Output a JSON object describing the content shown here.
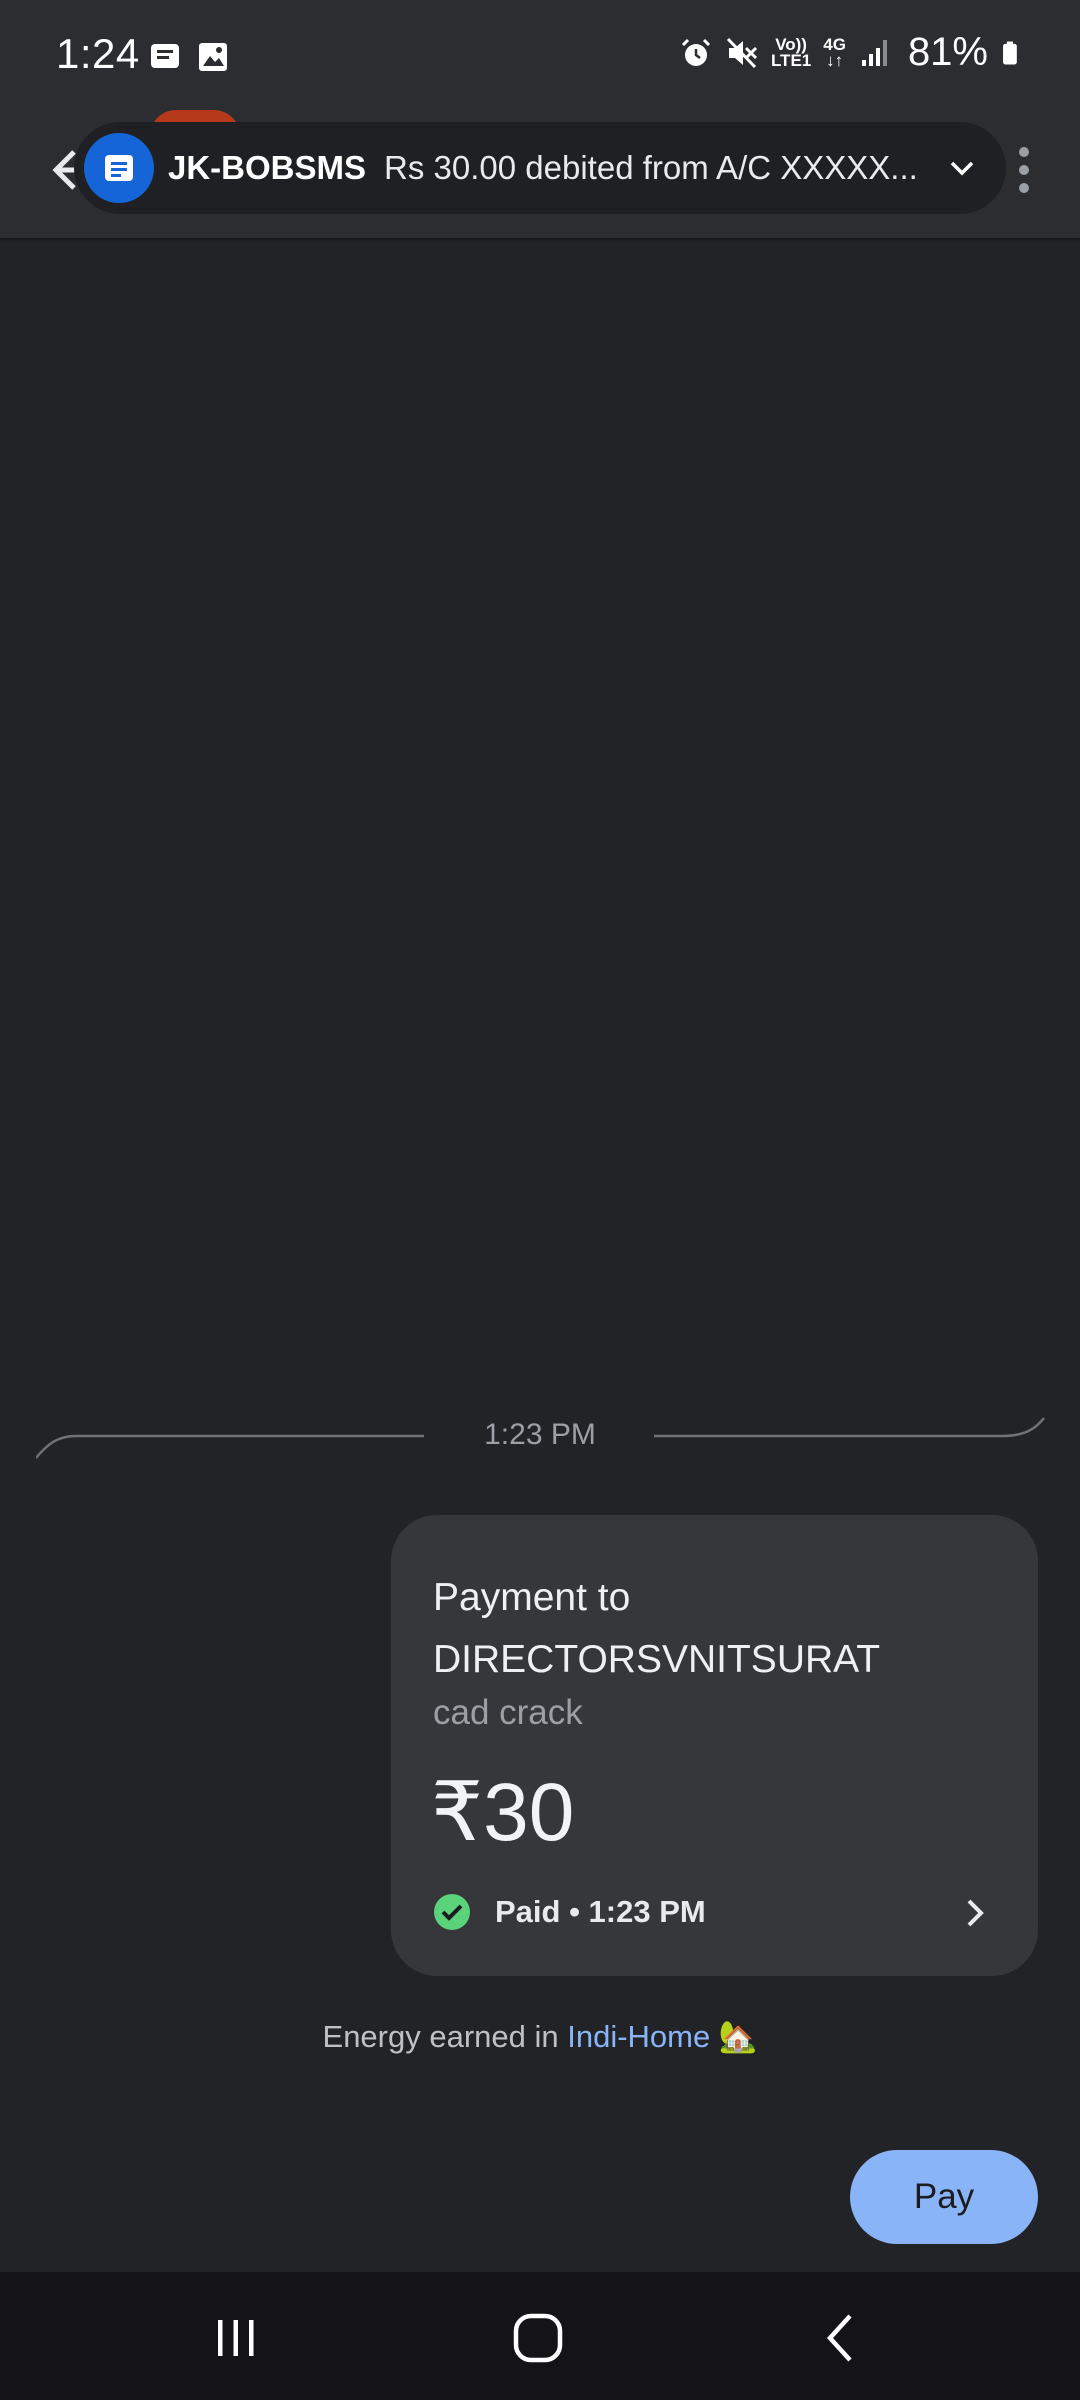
{
  "status_bar": {
    "time": "1:24",
    "volte_top": "Vo))",
    "volte_bottom": "LTE1",
    "network_type": "4G",
    "battery_percent": "81%",
    "icons": [
      "message-icon",
      "image-icon",
      "alarm-icon",
      "mute-icon",
      "volte-icon",
      "data-arrows-icon",
      "signal-icon",
      "battery-icon"
    ]
  },
  "header": {
    "back_icon": "arrow-back-icon",
    "more_icon": "more-vert-icon",
    "notification": {
      "sender": "JK-BOBSMS",
      "message": "Rs 30.00 debited from A/C XXXXX...",
      "icon": "message-icon",
      "expand_icon": "chevron-down-icon"
    }
  },
  "conversation": {
    "timestamp": "1:23 PM",
    "payment": {
      "title": "Payment to DIRECTORSVNITSURAT",
      "note": "cad crack",
      "amount": "₹30",
      "status": "Paid • 1:23 PM",
      "status_color": "#5bd37a"
    },
    "energy_prefix": "Energy earned in ",
    "energy_link": "Indi-Home",
    "energy_emoji": "🏡"
  },
  "actions": {
    "pay_label": "Pay"
  },
  "nav_bar": {
    "icons": [
      "recents-icon",
      "home-icon",
      "back-icon"
    ]
  },
  "colors": {
    "background": "#222327",
    "accent": "#8ab4f8",
    "card": "#36373b"
  }
}
